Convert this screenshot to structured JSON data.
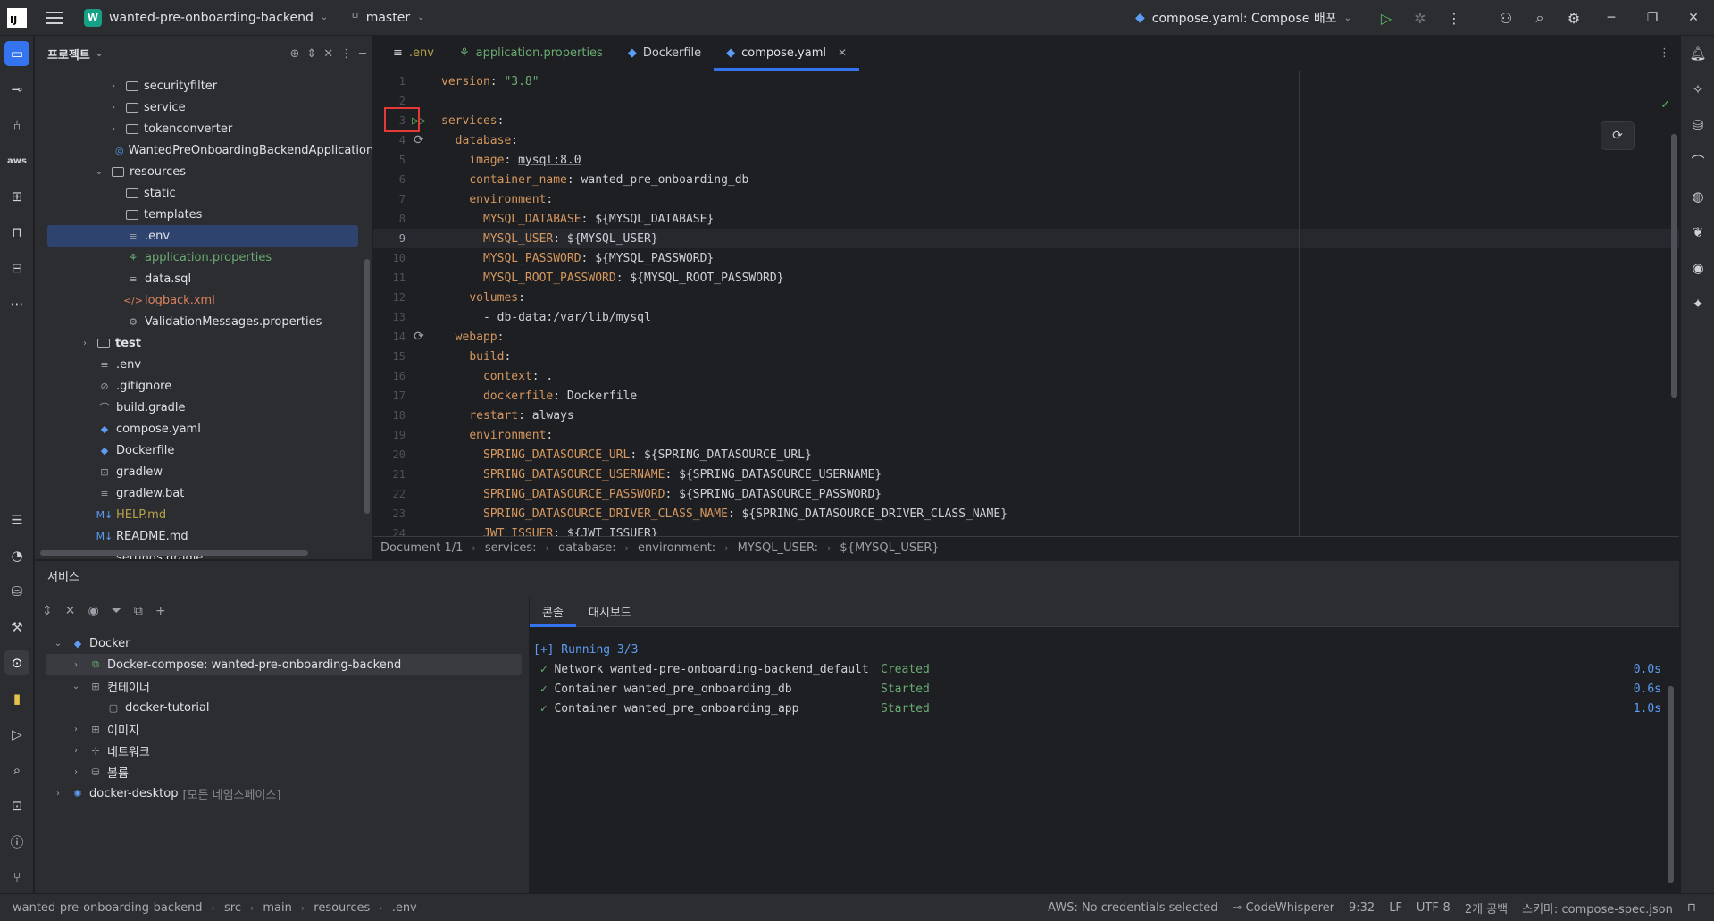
{
  "titlebar": {
    "project_badge": "W",
    "project_name": "wanted-pre-onboarding-backend",
    "branch": "master",
    "run_config": "compose.yaml: Compose 배포"
  },
  "project_panel": {
    "title": "프로젝트",
    "tree": [
      {
        "label": "securityfilter",
        "indent": 4,
        "kind": "folder",
        "chevron": "›"
      },
      {
        "label": "service",
        "indent": 4,
        "kind": "folder",
        "chevron": "›"
      },
      {
        "label": "tokenconverter",
        "indent": 4,
        "kind": "folder",
        "chevron": "›"
      },
      {
        "label": "WantedPreOnboardingBackendApplication",
        "indent": 4,
        "kind": "class"
      },
      {
        "label": "resources",
        "indent": 3,
        "kind": "folder",
        "chevron": "⌄"
      },
      {
        "label": "static",
        "indent": 4,
        "kind": "folder"
      },
      {
        "label": "templates",
        "indent": 4,
        "kind": "folder"
      },
      {
        "label": ".env",
        "indent": 4,
        "kind": "text",
        "selected": true
      },
      {
        "label": "application.properties",
        "indent": 4,
        "kind": "props",
        "color": "green"
      },
      {
        "label": "data.sql",
        "indent": 4,
        "kind": "text"
      },
      {
        "label": "logback.xml",
        "indent": 4,
        "kind": "xml",
        "color": "orange"
      },
      {
        "label": "ValidationMessages.properties",
        "indent": 4,
        "kind": "gear"
      },
      {
        "label": "test",
        "indent": 2,
        "kind": "folder",
        "chevron": "›",
        "bold": true
      },
      {
        "label": ".env",
        "indent": 2,
        "kind": "text"
      },
      {
        "label": ".gitignore",
        "indent": 2,
        "kind": "ignore"
      },
      {
        "label": "build.gradle",
        "indent": 2,
        "kind": "gradle"
      },
      {
        "label": "compose.yaml",
        "indent": 2,
        "kind": "docker"
      },
      {
        "label": "Dockerfile",
        "indent": 2,
        "kind": "docker"
      },
      {
        "label": "gradlew",
        "indent": 2,
        "kind": "terminal"
      },
      {
        "label": "gradlew.bat",
        "indent": 2,
        "kind": "text"
      },
      {
        "label": "HELP.md",
        "indent": 2,
        "kind": "md",
        "color": "yellow"
      },
      {
        "label": "README.md",
        "indent": 2,
        "kind": "md"
      },
      {
        "label": "settings.gradle",
        "indent": 2,
        "kind": "gradle"
      }
    ]
  },
  "editor": {
    "tabs": [
      {
        "label": ".env",
        "icon": "text-icon",
        "active": false
      },
      {
        "label": "application.properties",
        "icon": "spring-icon",
        "active": false
      },
      {
        "label": "Dockerfile",
        "icon": "docker-icon",
        "active": false
      },
      {
        "label": "compose.yaml",
        "icon": "docker-icon",
        "active": true
      }
    ],
    "lines": [
      {
        "n": "1",
        "indent": 0,
        "key": "version",
        "value": "\"3.8\"",
        "vclass": "s"
      },
      {
        "n": "2",
        "indent": 0,
        "key": "",
        "value": ""
      },
      {
        "n": "3",
        "indent": 0,
        "key": "services",
        "value": "",
        "gutter": "run"
      },
      {
        "n": "4",
        "indent": 1,
        "key": "database",
        "value": "",
        "gutter": "refresh"
      },
      {
        "n": "5",
        "indent": 2,
        "key": "image",
        "value": "mysql:8.0",
        "underline": "mysql"
      },
      {
        "n": "6",
        "indent": 2,
        "key": "container_name",
        "value": "wanted_pre_onboarding_db"
      },
      {
        "n": "7",
        "indent": 2,
        "key": "environment",
        "value": ""
      },
      {
        "n": "8",
        "indent": 3,
        "key": "MYSQL_DATABASE",
        "value": "${MYSQL_DATABASE}"
      },
      {
        "n": "9",
        "indent": 3,
        "key": "MYSQL_USER",
        "value": "${MYSQL_USER}",
        "current": true
      },
      {
        "n": "10",
        "indent": 3,
        "key": "MYSQL_PASSWORD",
        "value": "${MYSQL_PASSWORD}"
      },
      {
        "n": "11",
        "indent": 3,
        "key": "MYSQL_ROOT_PASSWORD",
        "value": "${MYSQL_ROOT_PASSWORD}"
      },
      {
        "n": "12",
        "indent": 2,
        "key": "volumes",
        "value": ""
      },
      {
        "n": "13",
        "indent": 3,
        "key": "",
        "value": "- db-data:/var/lib/mysql"
      },
      {
        "n": "14",
        "indent": 1,
        "key": "webapp",
        "value": "",
        "gutter": "refresh"
      },
      {
        "n": "15",
        "indent": 2,
        "key": "build",
        "value": ""
      },
      {
        "n": "16",
        "indent": 3,
        "key": "context",
        "value": "."
      },
      {
        "n": "17",
        "indent": 3,
        "key": "dockerfile",
        "value": "Dockerfile"
      },
      {
        "n": "18",
        "indent": 2,
        "key": "restart",
        "value": "always"
      },
      {
        "n": "19",
        "indent": 2,
        "key": "environment",
        "value": ""
      },
      {
        "n": "20",
        "indent": 3,
        "key": "SPRING_DATASOURCE_URL",
        "value": "${SPRING_DATASOURCE_URL}"
      },
      {
        "n": "21",
        "indent": 3,
        "key": "SPRING_DATASOURCE_USERNAME",
        "value": "${SPRING_DATASOURCE_USERNAME}"
      },
      {
        "n": "22",
        "indent": 3,
        "key": "SPRING_DATASOURCE_PASSWORD",
        "value": "${SPRING_DATASOURCE_PASSWORD}"
      },
      {
        "n": "23",
        "indent": 3,
        "key": "SPRING_DATASOURCE_DRIVER_CLASS_NAME",
        "value": "${SPRING_DATASOURCE_DRIVER_CLASS_NAME}"
      },
      {
        "n": "24",
        "indent": 3,
        "key": "JWT_ISSUER",
        "value": "${JWT_ISSUER}"
      }
    ],
    "breadcrumbs": [
      "Document 1/1",
      "services:",
      "database:",
      "environment:",
      "MYSQL_USER:",
      "${MYSQL_USER}"
    ]
  },
  "services": {
    "title": "서비스",
    "tree": [
      {
        "label": "Docker",
        "indent": 0,
        "chevron": "⌄",
        "icon": "docker-icon"
      },
      {
        "label": "Docker-compose: wanted-pre-onboarding-backend",
        "indent": 1,
        "chevron": "›",
        "icon": "compose-icon",
        "selected": true
      },
      {
        "label": "컨테이너",
        "indent": 1,
        "chevron": "⌄",
        "icon": "containers-icon"
      },
      {
        "label": "docker-tutorial",
        "indent": 2,
        "icon": "container-icon"
      },
      {
        "label": "이미지",
        "indent": 1,
        "chevron": "›",
        "icon": "images-icon"
      },
      {
        "label": "네트워크",
        "indent": 1,
        "chevron": "›",
        "icon": "network-icon"
      },
      {
        "label": "볼륨",
        "indent": 1,
        "chevron": "›",
        "icon": "volume-icon"
      },
      {
        "label": "docker-desktop",
        "suffix": "[모든 네임스페이스]",
        "indent": 0,
        "chevron": "›",
        "icon": "k8s-icon"
      }
    ],
    "console_tabs": [
      "콘솔",
      "대시보드"
    ],
    "console": {
      "header": "[+] Running 3/3",
      "lines": [
        {
          "text": "Network wanted-pre-onboarding-backend_default",
          "status": "Created",
          "time": "0.0s"
        },
        {
          "text": "Container wanted_pre_onboarding_db",
          "status": "Started",
          "time": "0.6s"
        },
        {
          "text": "Container wanted_pre_onboarding_app",
          "status": "Started",
          "time": "1.0s"
        }
      ]
    }
  },
  "statusbar": {
    "path": [
      "wanted-pre-onboarding-backend",
      "src",
      "main",
      "resources",
      ".env"
    ],
    "aws": "AWS: No credentials selected",
    "codewhisperer": "CodeWhisperer",
    "position": "9:32",
    "line_sep": "LF",
    "encoding": "UTF-8",
    "indent": "2개 공백",
    "schema": "스키마: compose-spec.json"
  }
}
